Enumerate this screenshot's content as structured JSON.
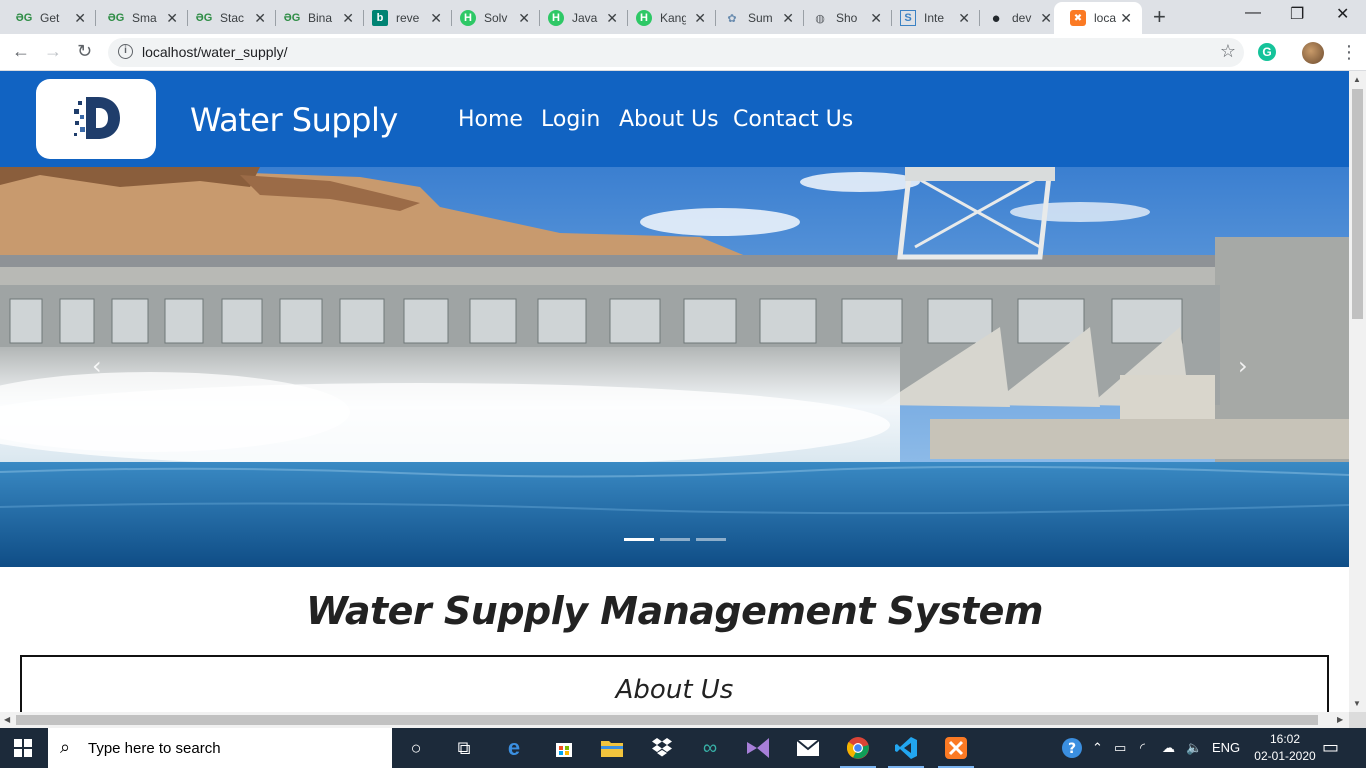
{
  "browser": {
    "tabs": [
      {
        "title": "Get",
        "favicon": "gfg-icon",
        "fav_text": "ƏG",
        "fav_color": "#2f8d46"
      },
      {
        "title": "Sma",
        "favicon": "gfg-icon",
        "fav_text": "ƏG",
        "fav_color": "#2f8d46"
      },
      {
        "title": "Stac",
        "favicon": "gfg-icon",
        "fav_text": "ƏG",
        "fav_color": "#2f8d46"
      },
      {
        "title": "Bina",
        "favicon": "gfg-icon",
        "fav_text": "ƏG",
        "fav_color": "#2f8d46"
      },
      {
        "title": "reve",
        "favicon": "bing-icon",
        "fav_text": "b",
        "fav_color": "#008373"
      },
      {
        "title": "Solv",
        "favicon": "hackerrank-icon",
        "fav_text": "H",
        "fav_color": "#2ec866"
      },
      {
        "title": "Java",
        "favicon": "hackerrank-icon",
        "fav_text": "H",
        "fav_color": "#2ec866"
      },
      {
        "title": "Kang",
        "favicon": "hackerrank-icon",
        "fav_text": "H",
        "fav_color": "#2ec866"
      },
      {
        "title": "Sum",
        "favicon": "tree-icon",
        "fav_text": "✿",
        "fav_color": "#6a8caf"
      },
      {
        "title": "Sho",
        "favicon": "globe-icon",
        "fav_text": "◍",
        "fav_color": "#5f6368"
      },
      {
        "title": "Inte",
        "favicon": "s-icon",
        "fav_text": "S",
        "fav_color": "#3b82c4"
      },
      {
        "title": "dev",
        "favicon": "github-icon",
        "fav_text": "●",
        "fav_color": "#24292e"
      },
      {
        "title": "loca",
        "favicon": "xampp-icon",
        "fav_text": "✖",
        "fav_color": "#fb7a24"
      }
    ],
    "url": "localhost/water_supply/"
  },
  "site": {
    "brand": "Water Supply",
    "nav": [
      "Home",
      "Login",
      "About Us",
      "Contact Us"
    ],
    "main_title": "Water Supply Management System",
    "about_heading": "About Us"
  },
  "carousel": {
    "slides": 3,
    "active_index": 0,
    "prev_glyph": "‹",
    "next_glyph": "›"
  },
  "taskbar": {
    "search_placeholder": "Type here to search",
    "language": "ENG",
    "time": "16:02",
    "date": "02-01-2020",
    "apps": [
      "task-view",
      "edge",
      "store",
      "file-explorer",
      "dropbox",
      "arduino",
      "visual-studio",
      "mail",
      "chrome",
      "vscode",
      "xampp"
    ]
  },
  "colors": {
    "nav_blue": "#1163c2",
    "tab_strip": "#dee1e6",
    "taskbar": "#1c2a3a"
  }
}
